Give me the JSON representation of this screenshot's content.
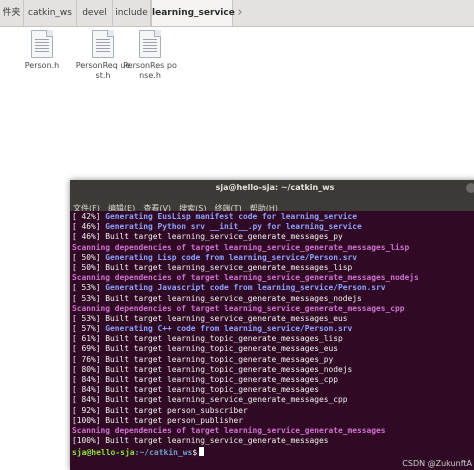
{
  "file_manager": {
    "breadcrumbs": [
      "件夹",
      "catkin_ws",
      "devel",
      "include",
      "learning_service"
    ],
    "next_arrow": "›",
    "files": [
      {
        "name": "Person.h",
        "icon": "text-file-icon"
      },
      {
        "name": "PersonReq uest.h",
        "icon": "text-file-icon"
      },
      {
        "name": "PersonRes ponse.h",
        "icon": "text-file-icon"
      }
    ]
  },
  "terminal": {
    "title": "sja@hello-sja: ~/catkin_ws",
    "menu": [
      "文件(F)",
      "编辑(E)",
      "查看(V)",
      "搜索(S)",
      "终端(T)",
      "帮助(H)"
    ],
    "lines": [
      {
        "style": "white",
        "text": "[ 42%] "
      },
      {
        "style": "white",
        "text": "[ 46%] "
      },
      {
        "style": "white",
        "text": "[ 46%] Built target learning_service_generate_messages_py"
      },
      {
        "style": "purple",
        "text": "Scanning dependencies of target learning_service_generate_messages_lisp"
      },
      {
        "style": "white",
        "text": "[ 50%] "
      },
      {
        "style": "white",
        "text": "[ 50%] Built target learning_service_generate_messages_lisp"
      },
      {
        "style": "purple",
        "text": "Scanning dependencies of target learning_service_generate_messages_nodejs"
      },
      {
        "style": "white",
        "text": "[ 53%] "
      },
      {
        "style": "white",
        "text": "[ 53%] Built target learning_service_generate_messages_nodejs"
      },
      {
        "style": "purple",
        "text": "Scanning dependencies of target learning_service_generate_messages_cpp"
      },
      {
        "style": "white",
        "text": "[ 53%] Built target learning_service_generate_messages_eus"
      },
      {
        "style": "white",
        "text": "[ 57%] "
      },
      {
        "style": "white",
        "text": "[ 61%] Built target learning_topic_generate_messages_lisp"
      },
      {
        "style": "white",
        "text": "[ 69%] Built target learning_topic_generate_messages_eus"
      },
      {
        "style": "white",
        "text": "[ 76%] Built target learning_topic_generate_messages_py"
      },
      {
        "style": "white",
        "text": "[ 80%] Built target learning_topic_generate_messages_nodejs"
      },
      {
        "style": "white",
        "text": "[ 84%] Built target learning_topic_generate_messages_cpp"
      },
      {
        "style": "white",
        "text": "[ 84%] Built target learning_topic_generate_messages"
      },
      {
        "style": "white",
        "text": "[ 84%] Built target learning_service_generate_messages_cpp"
      },
      {
        "style": "white",
        "text": "[ 92%] Built target person_subscriber"
      },
      {
        "style": "white",
        "text": "[100%] Built target person_publisher"
      },
      {
        "style": "purple",
        "text": "Scanning dependencies of target learning_service_generate_messages"
      },
      {
        "style": "white",
        "text": "[100%] Built target learning_service_generate_messages"
      }
    ],
    "inline_blue": [
      {
        "line": 0,
        "text": "Generating EusLisp manifest code for learning_service"
      },
      {
        "line": 1,
        "text": "Generating Python srv __init__.py for learning_service"
      },
      {
        "line": 4,
        "text": "Generating Lisp code from learning_service/Person.srv"
      },
      {
        "line": 7,
        "text": "Generating Javascript code from learning_service/Person.srv"
      },
      {
        "line": 11,
        "text": "Generating C++ code from learning_service/Person.srv"
      }
    ],
    "prompt": {
      "user": "sja@hello-sja",
      "path": ":~/catkin_ws",
      "dollar": "$"
    },
    "colors": {
      "background": "#300a24",
      "blue": "#8ea2ff",
      "purple": "#d070d0",
      "prompt_user": "#8ae234",
      "prompt_path": "#729fcf"
    }
  },
  "watermark": "CSDN @ZukunftA"
}
